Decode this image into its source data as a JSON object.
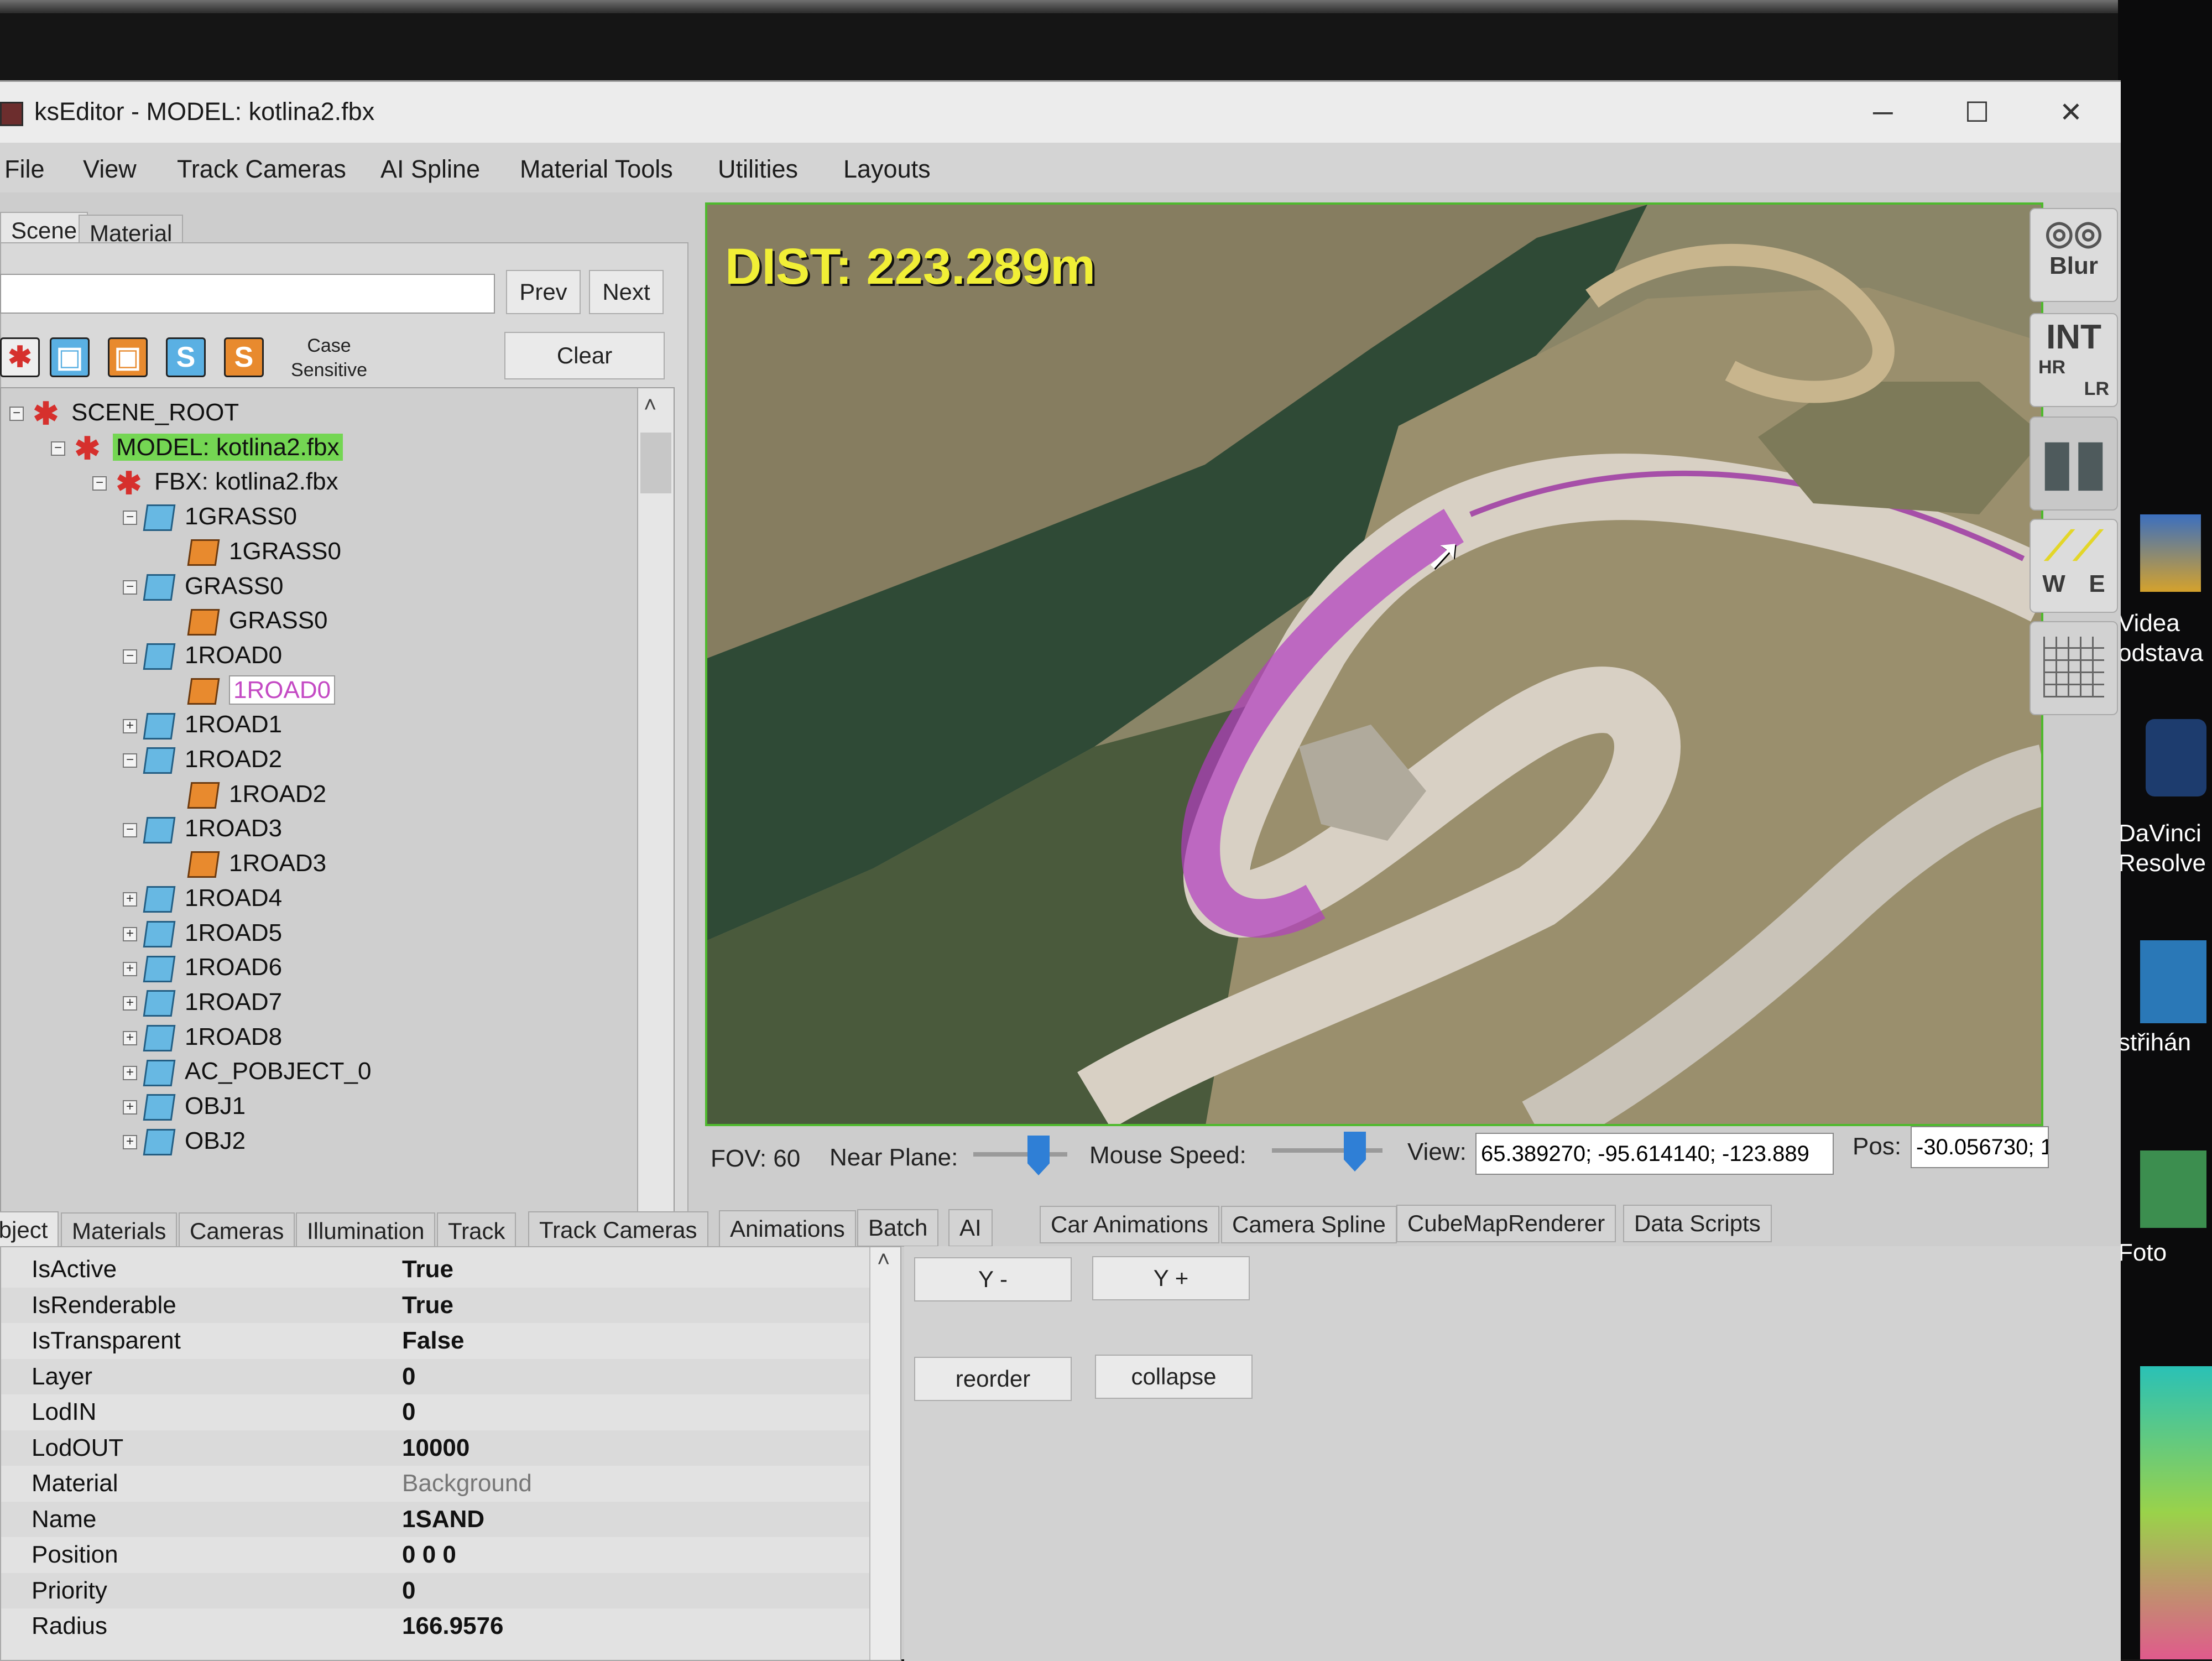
{
  "window": {
    "title": "ksEditor - MODEL: kotlina2.fbx",
    "minimize": "─",
    "maximize": "☐",
    "close": "✕"
  },
  "menu": [
    "File",
    "View",
    "Track Cameras",
    "AI Spline",
    "Material Tools",
    "Utilities",
    "Layouts"
  ],
  "left_tabs": [
    "Scene",
    "Material"
  ],
  "search": {
    "value": "",
    "prev": "Prev",
    "next": "Next",
    "clear": "Clear",
    "case_sensitive": "Case\nSensitive"
  },
  "tree": [
    {
      "label": "SCENE_ROOT",
      "kind": "scene",
      "exp": "−",
      "style": ""
    },
    {
      "label": "MODEL: kotlina2.fbx",
      "kind": "scene",
      "exp": "−",
      "style": "hl"
    },
    {
      "label": "FBX: kotlina2.fbx",
      "kind": "scene",
      "exp": "−",
      "style": ""
    },
    {
      "label": "1GRASS0",
      "kind": "node",
      "exp": "−",
      "style": ""
    },
    {
      "label": "1GRASS0",
      "kind": "leaf",
      "exp": "",
      "style": ""
    },
    {
      "label": "GRASS0",
      "kind": "node",
      "exp": "−",
      "style": ""
    },
    {
      "label": "GRASS0",
      "kind": "leaf",
      "exp": "",
      "style": ""
    },
    {
      "label": "1ROAD0",
      "kind": "node",
      "exp": "−",
      "style": ""
    },
    {
      "label": "1ROAD0",
      "kind": "leaf",
      "exp": "",
      "style": "sel"
    },
    {
      "label": "1ROAD1",
      "kind": "node",
      "exp": "+",
      "style": ""
    },
    {
      "label": "1ROAD2",
      "kind": "node",
      "exp": "−",
      "style": ""
    },
    {
      "label": "1ROAD2",
      "kind": "leaf",
      "exp": "",
      "style": ""
    },
    {
      "label": "1ROAD3",
      "kind": "node",
      "exp": "−",
      "style": ""
    },
    {
      "label": "1ROAD3",
      "kind": "leaf",
      "exp": "",
      "style": ""
    },
    {
      "label": "1ROAD4",
      "kind": "node",
      "exp": "+",
      "style": ""
    },
    {
      "label": "1ROAD5",
      "kind": "node",
      "exp": "+",
      "style": ""
    },
    {
      "label": "1ROAD6",
      "kind": "node",
      "exp": "+",
      "style": ""
    },
    {
      "label": "1ROAD7",
      "kind": "node",
      "exp": "+",
      "style": ""
    },
    {
      "label": "1ROAD8",
      "kind": "node",
      "exp": "+",
      "style": ""
    },
    {
      "label": "AC_POBJECT_0",
      "kind": "node",
      "exp": "+",
      "style": ""
    },
    {
      "label": "OBJ1",
      "kind": "node",
      "exp": "+",
      "style": ""
    },
    {
      "label": "OBJ2",
      "kind": "node",
      "exp": "+",
      "style": ""
    }
  ],
  "viewport": {
    "dist": "DIST: 223.289m"
  },
  "side_tools": {
    "blur": "Blur",
    "int": "INT",
    "hr": "HR",
    "lr": "LR",
    "w": "W",
    "e": "E"
  },
  "statusbar": {
    "fov": "FOV: 60",
    "near_plane": "Near Plane:",
    "mouse_speed": "Mouse Speed:",
    "view_label": "View:",
    "view_value": "65.389270; -95.614140; -123.889",
    "pos_label": "Pos:",
    "pos_value": "-30.056730; 1"
  },
  "bottom_tabs": [
    "Object",
    "Materials",
    "Cameras",
    "Illumination",
    "Track",
    "Track Cameras",
    "Animations",
    "Batch",
    "AI",
    "Car Animations",
    "Camera Spline",
    "CubeMapRenderer",
    "Data Scripts"
  ],
  "properties": [
    {
      "k": "IsActive",
      "v": "True"
    },
    {
      "k": "IsRenderable",
      "v": "True"
    },
    {
      "k": "IsTransparent",
      "v": "False"
    },
    {
      "k": "Layer",
      "v": "0"
    },
    {
      "k": "LodIN",
      "v": "0"
    },
    {
      "k": "LodOUT",
      "v": "10000"
    },
    {
      "k": "Material",
      "v": "Background",
      "dim": true
    },
    {
      "k": "Name",
      "v": "1SAND"
    },
    {
      "k": "Position",
      "v": "0 0 0"
    },
    {
      "k": "Priority",
      "v": "0"
    },
    {
      "k": "Radius",
      "v": "166.9576"
    }
  ],
  "actions": {
    "y_minus": "Y -",
    "y_plus": "Y +",
    "reorder": "reorder",
    "collapse": "collapse"
  },
  "desktop": {
    "videa": "Videa\nodstava",
    "davinci": "DaVinci\nResolve",
    "strihani": "střihán",
    "foto": "Foto"
  }
}
